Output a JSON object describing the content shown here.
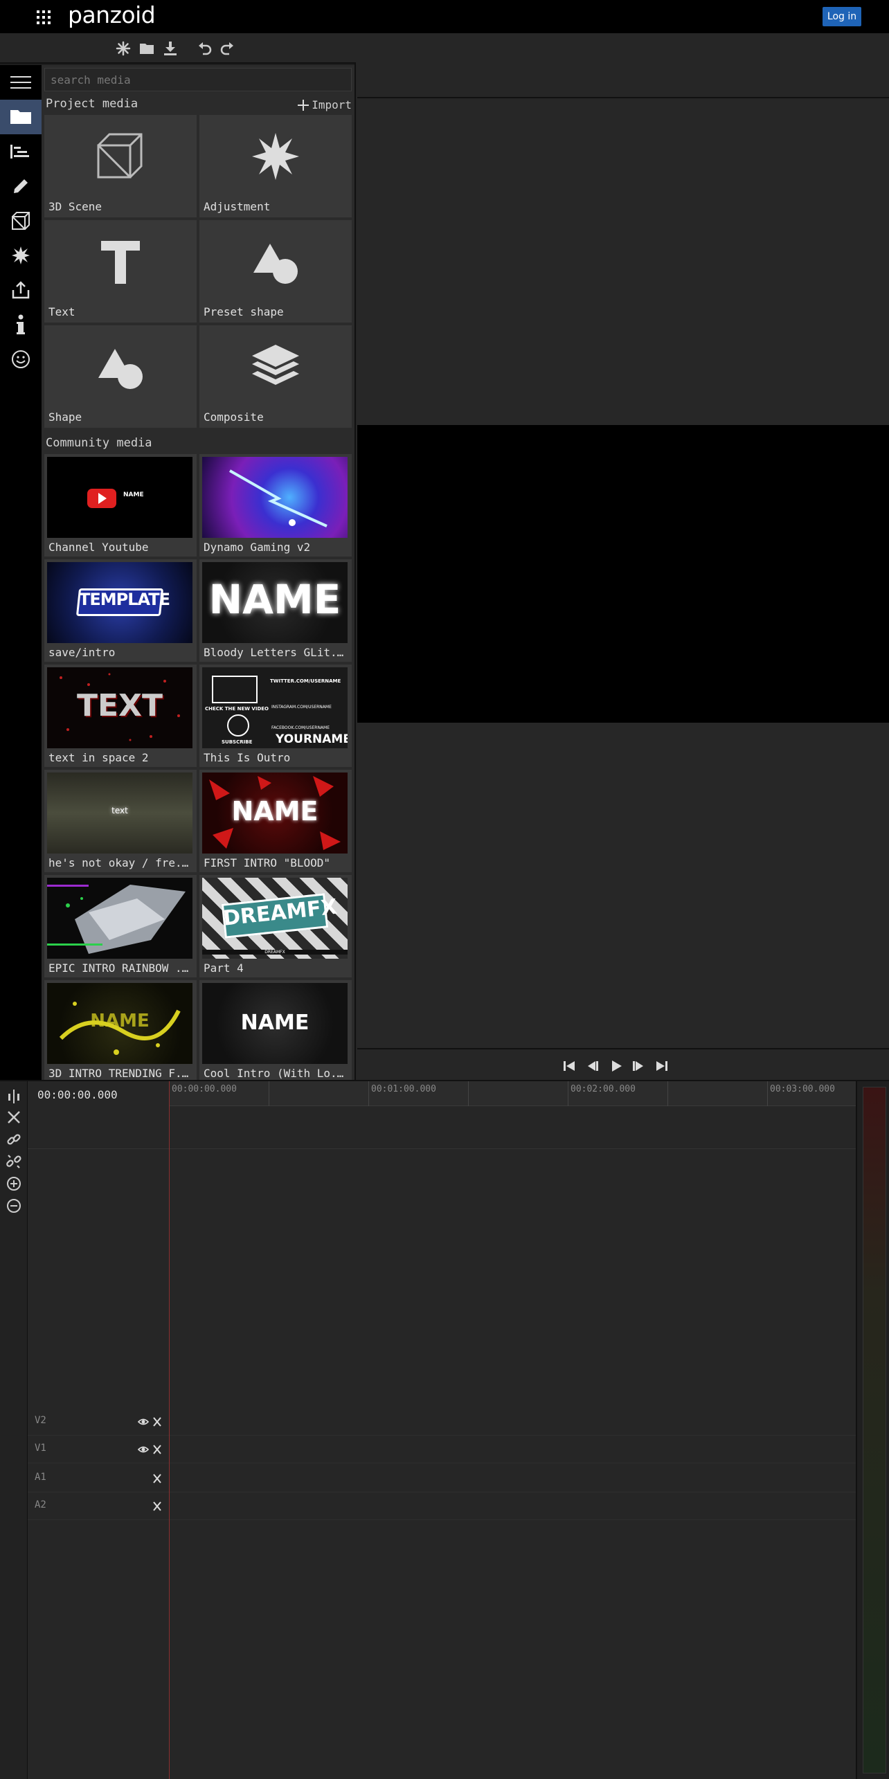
{
  "header": {
    "brand": "panzoid",
    "login_label": "Log in"
  },
  "toolbar": {
    "icons": [
      "new-project-icon",
      "open-folder-icon",
      "download-icon",
      "undo-icon",
      "redo-icon"
    ]
  },
  "sidenav": {
    "items": [
      "menu-icon",
      "media-folder-icon",
      "timeline-icon",
      "edit-icon",
      "3d-cube-icon",
      "effects-icon",
      "export-icon",
      "info-icon",
      "smiley-icon"
    ],
    "active": "media-folder-icon"
  },
  "media": {
    "search_placeholder": "search media",
    "project_title": "Project media",
    "import_label": "Import",
    "project_items": [
      {
        "label": "3D Scene",
        "icon": "cube-icon"
      },
      {
        "label": "Adjustment",
        "icon": "starburst-icon"
      },
      {
        "label": "Text",
        "icon": "text-t-icon"
      },
      {
        "label": "Preset shape",
        "icon": "shapes-icon"
      },
      {
        "label": "Shape",
        "icon": "shapes-icon"
      },
      {
        "label": "Composite",
        "icon": "layers-icon"
      }
    ],
    "community_title": "Community media",
    "community_items": [
      {
        "label": "Channel Youtube",
        "thumb_text": "NAME"
      },
      {
        "label": "Dynamo Gaming v2",
        "thumb_text": ""
      },
      {
        "label": "save/intro",
        "thumb_text": "TEMPLATE"
      },
      {
        "label": "Bloody Letters GLit...",
        "thumb_text": "NAME"
      },
      {
        "label": "text in space 2",
        "thumb_text": "TEXT"
      },
      {
        "label": "This Is Outro",
        "thumb_text": "YOURNAME"
      },
      {
        "label": "he's not okay / fre...",
        "thumb_text": "text"
      },
      {
        "label": "FIRST INTRO \"BLOOD\"",
        "thumb_text": "NAME"
      },
      {
        "label": "EPIC INTRO RAINBOW ...",
        "thumb_text": ""
      },
      {
        "label": "Part 4",
        "thumb_text": "DREAMFX"
      },
      {
        "label": "3D INTRO TRENDING F...",
        "thumb_text": "NAME"
      },
      {
        "label": "Cool Intro (With Lo...",
        "thumb_text": "NAME"
      }
    ],
    "outro_texts": {
      "twitter": "TWITTER.COM/USERNAME",
      "check": "CHECK THE NEW VIDEO",
      "instagram": "INSTAGRAM.COM/USERNAME",
      "subscribe": "SUBSCRIBE",
      "facebook": "FACEBOOK.COM/USERNAME"
    },
    "part4_sub": "DREAMFX"
  },
  "transport": {
    "icons": [
      "skip-start-icon",
      "step-back-icon",
      "play-icon",
      "step-forward-icon",
      "skip-end-icon"
    ]
  },
  "timeline": {
    "timecode": "00:00:00.000",
    "ruler_labels": [
      "00:00:00.000",
      "00:01:00.000",
      "00:02:00.000",
      "00:03:00.000"
    ],
    "tracks": [
      {
        "name": "V2",
        "has_eye": true
      },
      {
        "name": "V1",
        "has_eye": true
      },
      {
        "name": "A1",
        "has_eye": false
      },
      {
        "name": "A2",
        "has_eye": false
      }
    ],
    "tools": [
      "split-icon",
      "delete-icon",
      "link-icon",
      "unlink-icon",
      "zoom-in-icon",
      "zoom-out-icon"
    ]
  }
}
